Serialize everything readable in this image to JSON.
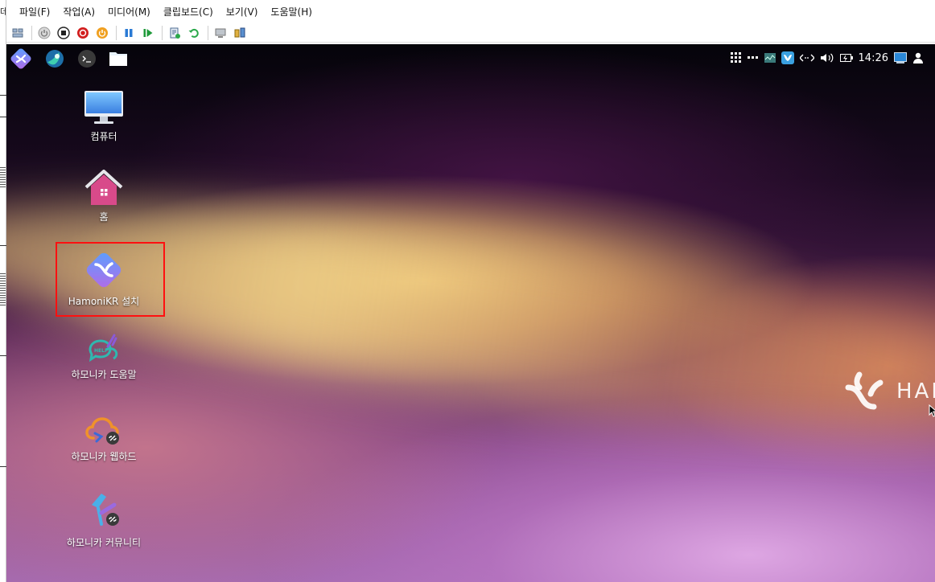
{
  "host": {
    "title_fragment": "데"
  },
  "menubar": {
    "items": [
      "파일(F)",
      "작업(A)",
      "미디어(M)",
      "클립보드(C)",
      "보기(V)",
      "도움말(H)"
    ]
  },
  "toolbar": {
    "buttons": [
      "ctrl-alt-del-icon",
      "start-icon",
      "turn-off-icon",
      "shutdown-icon",
      "power-reset-icon",
      "pause-icon",
      "resume-icon",
      "checkpoint-icon",
      "revert-icon",
      "enhanced-session-icon",
      "share-icon"
    ]
  },
  "panel": {
    "launchers": [
      "hamonikr-menu-icon",
      "web-browser-icon",
      "terminal-icon",
      "file-manager-icon"
    ],
    "clock": "14:26"
  },
  "desktop": {
    "icons": [
      {
        "label": "컴퓨터",
        "icon": "computer-icon"
      },
      {
        "label": "홈",
        "icon": "home-icon"
      },
      {
        "label": "HamoniKR 설치",
        "icon": "hamonikr-install-icon"
      },
      {
        "label": "하모니카 도움말",
        "icon": "help-icon"
      },
      {
        "label": "하모니카 웹하드",
        "icon": "webhard-icon"
      },
      {
        "label": "하모니카 커뮤니티",
        "icon": "community-icon"
      }
    ],
    "brand_text": "HAN"
  },
  "colors": {
    "highlight": "#ff1010",
    "brand_gradient_start": "#5aa0ff",
    "brand_gradient_end": "#b36ae8"
  }
}
